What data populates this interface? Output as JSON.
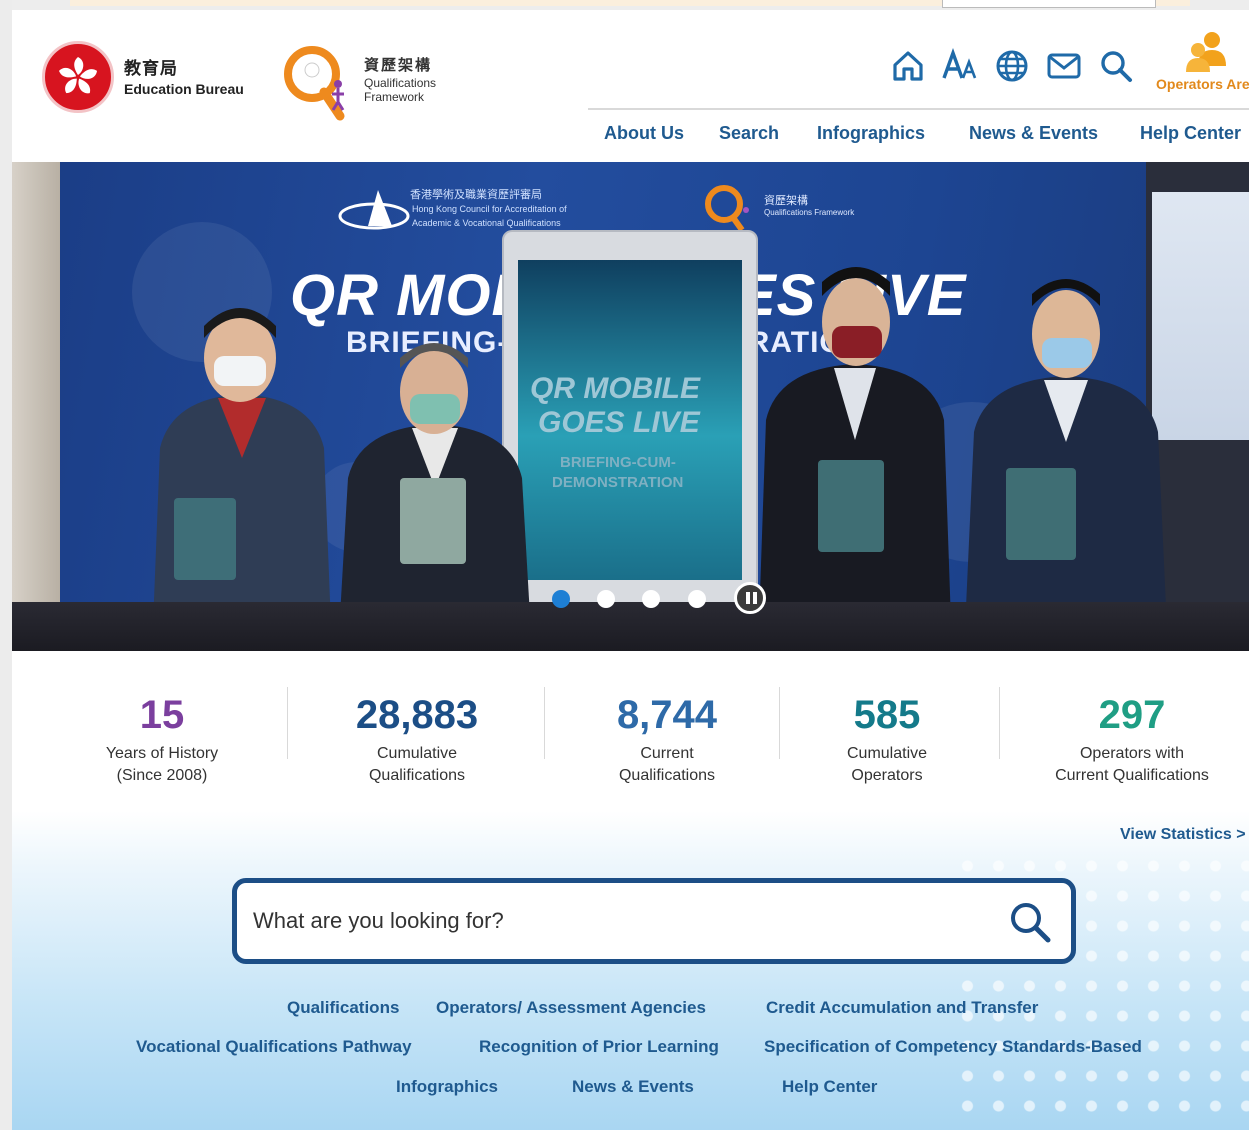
{
  "header": {
    "edb_name_zh": "教育局",
    "edb_name_en": "Education Bureau",
    "qf_name_zh": "資歷架構",
    "qf_name_en_line1": "Qualifications",
    "qf_name_en_line2": "Framework",
    "utility_icons": [
      "home-icon",
      "font-size-icon",
      "language-globe-icon",
      "mail-icon",
      "search-icon"
    ],
    "operators_area_label": "Operators Area",
    "nav": [
      "About Us",
      "Search",
      "Infographics",
      "News & Events",
      "Help Center"
    ]
  },
  "hero": {
    "council_zh": "香港學術及職業資歷評審局",
    "council_en_line1": "Hong Kong Council for Accreditation of",
    "council_en_line2": "Academic & Vocational Qualifications",
    "qf_mini_zh": "資歷架構",
    "qf_mini_en": "Qualifications Framework",
    "headline": "QR MOBILE GOES LIVE",
    "subheadline": "BRIEFING-CUM-DEMONSTRATION",
    "kiosk_line1": "QR MOBILE",
    "kiosk_line2": "GOES LIVE",
    "kiosk_line3": "BRIEFING-CUM-",
    "kiosk_line4": "DEMONSTRATION",
    "carousel": {
      "slides": 4,
      "active_index": 0,
      "paused_control": "pause-icon"
    }
  },
  "stats": [
    {
      "value": "15",
      "label_line1": "Years of History",
      "label_line2": "(Since 2008)",
      "color": "#7b3f9e"
    },
    {
      "value": "28,883",
      "label_line1": "Cumulative",
      "label_line2": "Qualifications",
      "color": "#1c4e86"
    },
    {
      "value": "8,744",
      "label_line1": "Current",
      "label_line2": "Qualifications",
      "color": "#2e6aa8"
    },
    {
      "value": "585",
      "label_line1": "Cumulative",
      "label_line2": "Operators",
      "color": "#147a8a"
    },
    {
      "value": "297",
      "label_line1": "Operators with",
      "label_line2": "Current Qualifications",
      "color": "#1f9e84"
    }
  ],
  "view_statistics": "View Statistics >",
  "search": {
    "placeholder": "What are you looking for?"
  },
  "quick_links": [
    [
      "Qualifications",
      "Operators/ Assessment Agencies",
      "Credit Accumulation and Transfer"
    ],
    [
      "Vocational Qualifications Pathway",
      "Recognition of Prior Learning",
      "Specification of Competency Standards-Based"
    ],
    [
      "Infographics",
      "News & Events",
      "Help Center"
    ]
  ],
  "colors": {
    "nav": "#1f5a8f",
    "operators": "#e2891b",
    "search_border": "#1c4e86",
    "carousel_active": "#1e7fd4"
  }
}
